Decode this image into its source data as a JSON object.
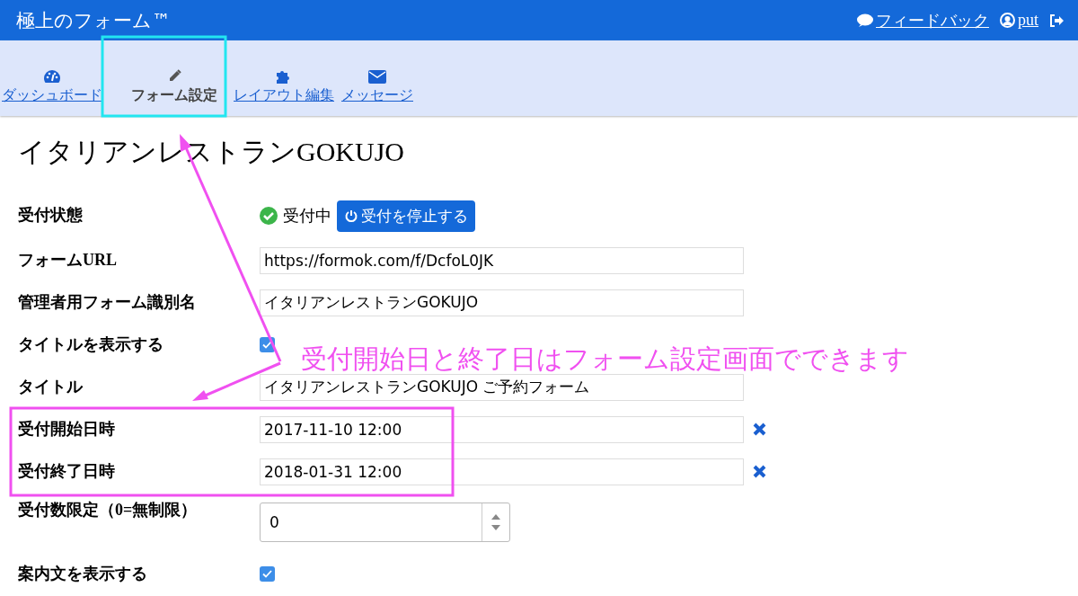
{
  "app": {
    "title": "極上のフォーム™"
  },
  "header_links": [
    {
      "kind": "feedback",
      "label": "フィードバック"
    },
    {
      "kind": "user",
      "label": "put"
    },
    {
      "kind": "logout"
    }
  ],
  "nav": [
    {
      "kind": "dashboard",
      "label": "ダッシュボード",
      "selected": false
    },
    {
      "kind": "form",
      "label": "フォーム設定",
      "selected": true
    },
    {
      "kind": "layout",
      "label": "レイアウト編集",
      "selected": false
    },
    {
      "kind": "message",
      "label": "メッセージ",
      "selected": false
    }
  ],
  "page_title": "イタリアンレストランGOKUJO",
  "fields": [
    {
      "kind": "status",
      "label": "受付状態",
      "status": "受付中",
      "button": "受付を停止する"
    },
    {
      "kind": "text",
      "label": "フォームURL",
      "value": "https://formok.com/f/DcfoL0JK"
    },
    {
      "kind": "text",
      "label": "管理者用フォーム識別名",
      "value": "イタリアンレストランGOKUJO"
    },
    {
      "kind": "checkbox",
      "label": "タイトルを表示する",
      "checked": true
    },
    {
      "kind": "text",
      "label": "タイトル",
      "value": "イタリアンレストランGOKUJO ご予約フォーム"
    },
    {
      "kind": "datetime",
      "label": "受付開始日時",
      "value": "2017-11-10 12:00"
    },
    {
      "kind": "datetime",
      "label": "受付終了日時",
      "value": "2018-01-31 12:00"
    },
    {
      "kind": "number",
      "label": "受付数限定（0=無制限）",
      "value": "0"
    },
    {
      "kind": "checkbox",
      "label": "案内文を表示する",
      "checked": true
    }
  ],
  "annotation": {
    "note": "受付開始日と終了日はフォーム設定画面でできます"
  }
}
